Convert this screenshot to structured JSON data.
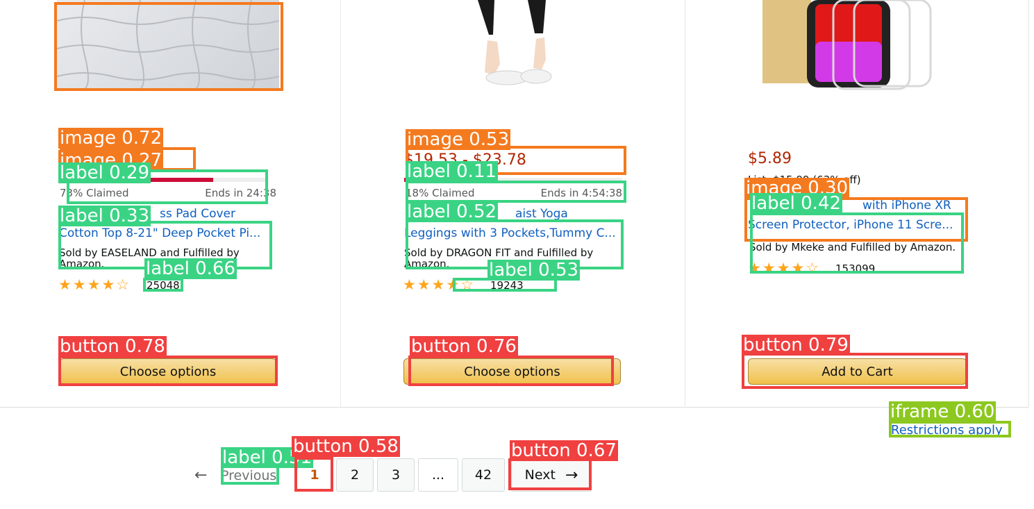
{
  "products": [
    {
      "image_alt": "Mattress pad top view",
      "price": "",
      "list_price": "",
      "claimed": "73% Claimed",
      "claimed_pct": 0.73,
      "ends": "Ends in 24:38",
      "title_line1": "ss Pad Cover",
      "title_line2": "Cotton Top 8-21\" Deep Pocket Pi...",
      "seller": "Sold by EASELAND and Fulfilled by Amazon.",
      "stars": "★★★★☆",
      "rating": 4.5,
      "reviews": "25048",
      "button": "Choose options"
    },
    {
      "image_alt": "Woman in leggings and white sneakers",
      "price": "$19.53 - $23.78",
      "list_price": "",
      "claimed": "18% Claimed",
      "claimed_pct": 0.18,
      "ends": "Ends in 4:54:38",
      "title_line1": "aist Yoga",
      "title_line2": "Leggings with 3 Pockets,Tummy C...",
      "seller": "Sold by DRAGON FIT and Fulfilled by Amazon.",
      "stars": "★★★★☆",
      "rating": 4.5,
      "reviews": "19243",
      "button": "Choose options"
    },
    {
      "image_alt": "Phone screen protectors",
      "price": "$5.89",
      "list_price": "List: $15.99 (63% off)",
      "claimed": "",
      "claimed_pct": 0,
      "ends": "",
      "title_line1": "with iPhone XR",
      "title_line2": "Screen Protector, iPhone 11 Scre...",
      "seller": "Sold by Mkeke and Fulfilled by Amazon.",
      "stars": "★★★★☆",
      "rating": 4.5,
      "reviews": "153099",
      "button": "Add to Cart"
    }
  ],
  "restrictions": "Restrictions apply",
  "pagination": {
    "prev_arrow": "←",
    "prev": "Previous",
    "pages": [
      "1",
      "2",
      "3",
      "...",
      "42"
    ],
    "current": "1",
    "next": "Next",
    "next_arrow": "→"
  },
  "overlays": [
    {
      "label": "image 0.72",
      "color": "#f47a1f"
    },
    {
      "label": "image 0.27",
      "color": "#f47a1f"
    },
    {
      "label": "label 0.29",
      "color": "#3ad384"
    },
    {
      "label": "label 0.33",
      "color": "#3ad384"
    },
    {
      "label": "label 0.66",
      "color": "#3ad384"
    },
    {
      "label": "button 0.78",
      "color": "#f04040"
    },
    {
      "label": "image 0.53",
      "color": "#f47a1f"
    },
    {
      "label": "label 0.11",
      "color": "#3ad384"
    },
    {
      "label": "label 0.52",
      "color": "#3ad384"
    },
    {
      "label": "label 0.53",
      "color": "#3ad384"
    },
    {
      "label": "button 0.76",
      "color": "#f04040"
    },
    {
      "label": "image 0.30",
      "color": "#f47a1f"
    },
    {
      "label": "label 0.42",
      "color": "#3ad384"
    },
    {
      "label": "button 0.79",
      "color": "#f04040"
    },
    {
      "label": "iframe 0.60",
      "color": "#8cc820"
    },
    {
      "label": "label 0.51",
      "color": "#3ad384"
    },
    {
      "label": "button 0.58",
      "color": "#f04040"
    },
    {
      "label": "button 0.67",
      "color": "#f04040"
    }
  ]
}
